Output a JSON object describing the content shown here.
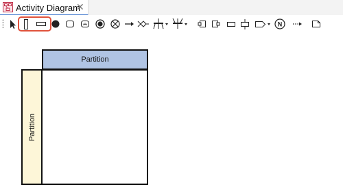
{
  "tab": {
    "title": "Activity Diagram",
    "close_glyph": "✕",
    "icon": "activity-diagram-icon"
  },
  "toolbar": {
    "tools": [
      {
        "name": "select-tool",
        "icon": "pointer-arrow-icon"
      },
      {
        "name": "vertical-partition-tool",
        "icon": "vertical-partition-icon"
      },
      {
        "name": "horizontal-partition-tool",
        "icon": "horizontal-partition-icon"
      },
      {
        "name": "initial-node-tool",
        "icon": "initial-node-icon"
      },
      {
        "name": "action-tool",
        "icon": "action-icon"
      },
      {
        "name": "call-behavior-action-tool",
        "icon": "call-behavior-action-icon"
      },
      {
        "name": "activity-final-tool",
        "icon": "activity-final-icon"
      },
      {
        "name": "flow-final-tool",
        "icon": "flow-final-icon"
      },
      {
        "name": "control-flow-tool",
        "icon": "control-flow-arrow-icon"
      },
      {
        "name": "decision-node-tool",
        "icon": "decision-node-icon"
      },
      {
        "name": "fork-node-tool",
        "icon": "fork-node-icon"
      },
      {
        "name": "join-node-tool",
        "icon": "join-node-icon"
      },
      {
        "name": "input-pin-tool",
        "icon": "input-pin-icon"
      },
      {
        "name": "output-pin-tool",
        "icon": "output-pin-icon"
      },
      {
        "name": "object-node-tool",
        "icon": "object-node-icon"
      },
      {
        "name": "central-buffer-tool",
        "icon": "central-buffer-icon"
      },
      {
        "name": "send-signal-tool",
        "icon": "send-signal-icon"
      },
      {
        "name": "note-tool",
        "icon": "note-icon"
      },
      {
        "name": "object-flow-tool",
        "icon": "object-flow-icon"
      },
      {
        "name": "comment-tool",
        "icon": "comment-icon"
      }
    ],
    "highlighted_tools": [
      "vertical-partition-tool",
      "horizontal-partition-tool"
    ],
    "note_glyph": "N"
  },
  "diagram": {
    "horizontal_partition_label": "Partition",
    "vertical_partition_label": "Partition"
  },
  "colors": {
    "highlight_border": "#e0523c",
    "partition_header": "#b0c4e4",
    "partition_side": "#fdf6d8",
    "tab_accent": "#4a7fd0"
  }
}
